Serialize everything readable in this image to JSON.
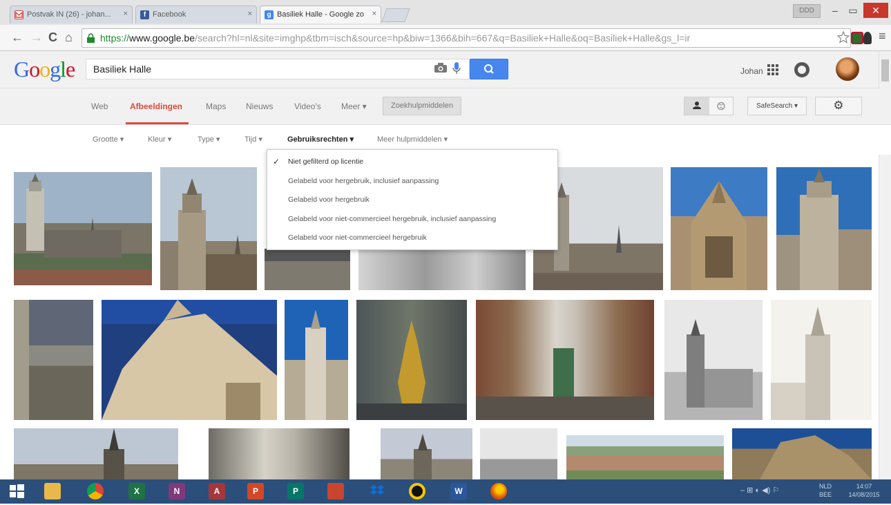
{
  "browser": {
    "tabs": [
      {
        "title": "Postvak IN (26) - johan...",
        "favicon_color": "#d44638"
      },
      {
        "title": "Facebook",
        "favicon_color": "#3b5998"
      },
      {
        "title": "Basiliek Halle - Google zo",
        "favicon_color": "#4285f4"
      }
    ],
    "tab_close_glyph": "×",
    "window_controls": {
      "minimize": "–",
      "maximize": "▭",
      "close": "✕"
    },
    "nav": {
      "back": "←",
      "forward": "→",
      "reload": "C",
      "home": "⌂"
    },
    "url": {
      "scheme": "https://",
      "host": "www.google.be",
      "path": "/search?hl=nl&site=imghp&tbm=isch&source=hp&biw=1366&bih=667&q=Basiliek+Halle&oq=Basiliek+Halle&gs_l=ir"
    },
    "user_box": "DDD",
    "menu_glyph": "≡"
  },
  "google": {
    "logo_letters": [
      {
        "ch": "G",
        "color": "#3369e8"
      },
      {
        "ch": "o",
        "color": "#d50f25"
      },
      {
        "ch": "o",
        "color": "#eeb211"
      },
      {
        "ch": "g",
        "color": "#3369e8"
      },
      {
        "ch": "l",
        "color": "#009925"
      },
      {
        "ch": "e",
        "color": "#d50f25"
      }
    ],
    "search_query": "Basiliek Halle",
    "user_name": "Johan",
    "nav_tabs": [
      "Web",
      "Afbeeldingen",
      "Maps",
      "Nieuws",
      "Video's",
      "Meer ▾"
    ],
    "active_tab": "Afbeeldingen",
    "tools_label": "Zoekhulpmiddelen",
    "safesearch_label": "SafeSearch ▾",
    "gear_glyph": "⚙",
    "filters": [
      "Grootte ▾",
      "Kleur ▾",
      "Type ▾",
      "Tijd ▾",
      "Gebruiksrechten ▾",
      "Meer hulpmiddelen ▾"
    ],
    "active_filter": "Gebruiksrechten ▾",
    "usage_rights_menu": {
      "check_glyph": "✓",
      "items": [
        "Niet gefilterd op licentie",
        "Gelabeld voor hergebruik, inclusief aanpassing",
        "Gelabeld voor hergebruik",
        "Gelabeld voor niet-commercieel hergebruik, inclusief aanpassing",
        "Gelabeld voor niet-commercieel hergebruik"
      ],
      "selected": "Niet gefilterd op licentie"
    }
  },
  "taskbar": {
    "icons": [
      "windows-start",
      "file-explorer",
      "chrome",
      "excel",
      "onenote",
      "access",
      "powerpoint",
      "publisher",
      "tools",
      "dropbox",
      "norton",
      "word",
      "firefox"
    ],
    "tray_lang": "NLD",
    "tray_lang2": "BEE",
    "tray_time": "14:07",
    "tray_date": "14/08/2015"
  },
  "colors": {
    "accent_red": "#dd4b39",
    "search_blue": "#4787ed",
    "taskbar": "#2b4f7a"
  }
}
